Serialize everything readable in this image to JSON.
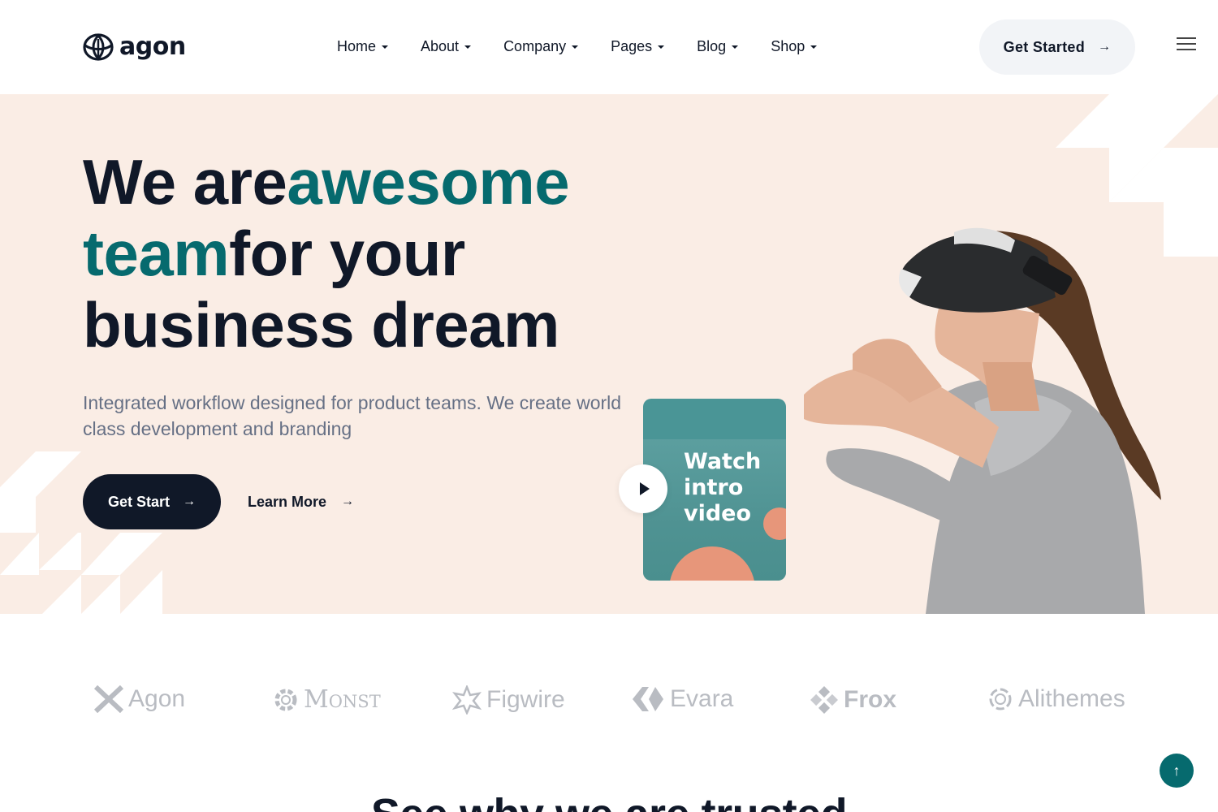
{
  "brand": {
    "name": "agon",
    "logo_icon": "leaf-globe-icon"
  },
  "nav": {
    "items": [
      {
        "label": "Home"
      },
      {
        "label": "About"
      },
      {
        "label": "Company"
      },
      {
        "label": "Pages"
      },
      {
        "label": "Blog"
      },
      {
        "label": "Shop"
      }
    ]
  },
  "header": {
    "cta_label": "Get Started",
    "arrow": "→",
    "menu_icon": "hamburger-menu-icon"
  },
  "hero": {
    "headline_part1": "We are",
    "headline_part2": "awesome",
    "headline_part3": "team",
    "headline_part4": "for your",
    "headline_part5": "business dream",
    "subtitle": "Integrated workflow designed for product teams. We create world class development and branding",
    "primary_button": "Get Start",
    "secondary_button": "Learn More",
    "arrow": "→",
    "video_card_label_1": "Watch",
    "video_card_label_2": "intro",
    "video_card_label_3": "video"
  },
  "brands": {
    "items": [
      {
        "name": "Agon"
      },
      {
        "name": "Monst"
      },
      {
        "name": "Figwire"
      },
      {
        "name": "Evara"
      },
      {
        "name": "Frox"
      },
      {
        "name": "Alithemes"
      }
    ]
  },
  "section": {
    "title": "See why we are trusted"
  },
  "scroll_top": {
    "icon": "arrow-up-icon",
    "glyph": "↑"
  },
  "colors": {
    "accent": "#066a6e",
    "dark": "#101828",
    "hero_bg": "#faede5",
    "muted": "#667085",
    "coral": "#e7967a"
  }
}
